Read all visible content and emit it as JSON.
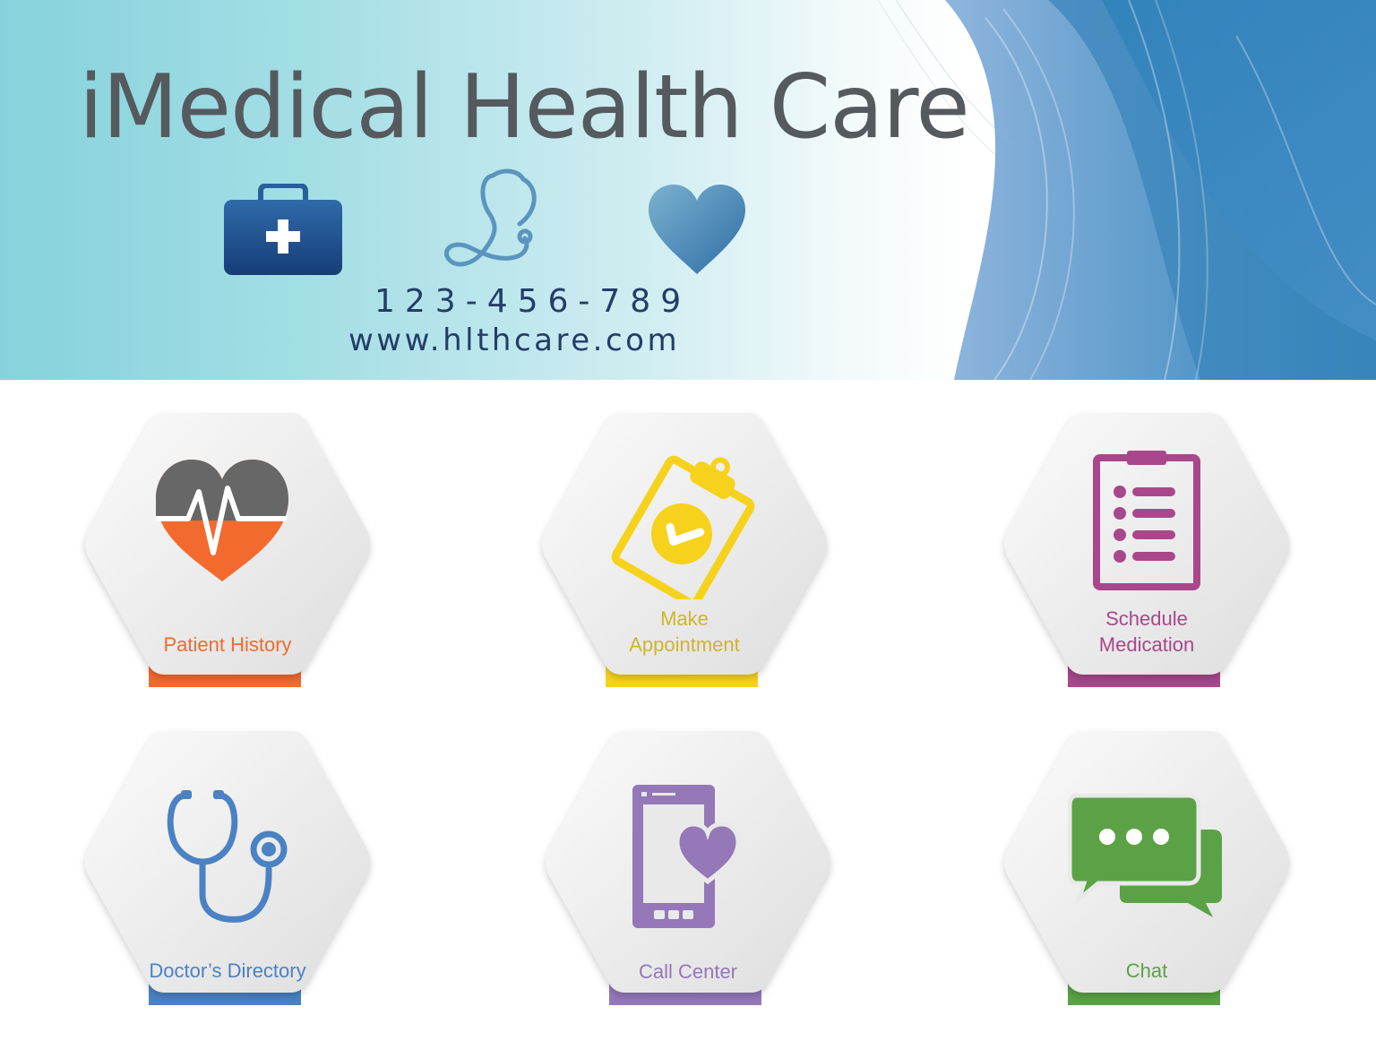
{
  "header": {
    "title": "iMedical Health Care",
    "phone": "123-456-789",
    "website": "www.hlthcare.com",
    "icons": [
      "first-aid-kit-icon",
      "stethoscope-icon",
      "heart-icon"
    ]
  },
  "colors": {
    "banner_gradient_start": "#86d2db",
    "banner_wave_blue": "#3b86bb",
    "title_gray": "#555a5e",
    "contact_navy": "#233d68",
    "orange": "#f26a2e",
    "yellow": "#f7d21d",
    "magenta": "#a8478b",
    "blue": "#4a82c3",
    "purple": "#9478b8",
    "green": "#5ba246"
  },
  "tiles": [
    {
      "label": "Patient History",
      "icon": "heart-pulse-icon",
      "color": "#f26a2e"
    },
    {
      "label": "Make\nAppointment",
      "icon": "clipboard-check-icon",
      "color": "#f7d21d"
    },
    {
      "label": "Schedule\nMedication",
      "icon": "checklist-icon",
      "color": "#a8478b"
    },
    {
      "label": "Doctor’s Directory",
      "icon": "stethoscope-icon",
      "color": "#4a82c3"
    },
    {
      "label": "Call Center",
      "icon": "phone-heart-icon",
      "color": "#9478b8"
    },
    {
      "label": "Chat",
      "icon": "chat-bubbles-icon",
      "color": "#5ba246"
    }
  ]
}
